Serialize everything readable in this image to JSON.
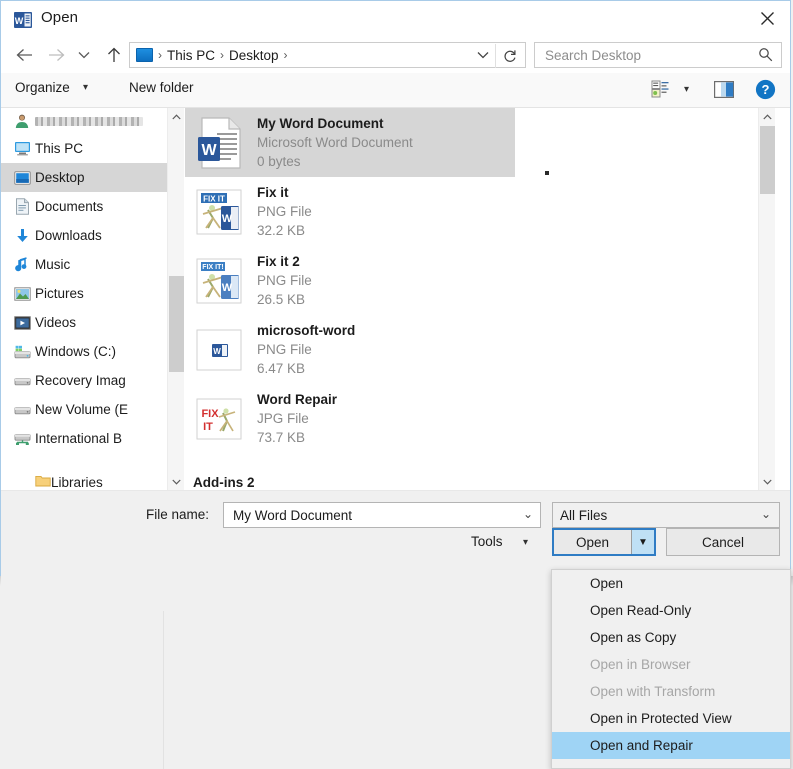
{
  "window": {
    "title": "Open",
    "title_icon": "word-document-icon",
    "close_icon": "close-icon"
  },
  "nav": {
    "back_icon": "arrow-left-icon",
    "forward_icon": "arrow-right-icon",
    "recent_icon": "chevron-down-icon",
    "up_icon": "arrow-up-icon",
    "breadcrumb_icon": "desktop-monitor-icon",
    "breadcrumbs": [
      "This PC",
      "Desktop"
    ],
    "separator": "›",
    "dropdown_icon": "chevron-down-icon",
    "refresh_icon": "refresh-icon"
  },
  "search": {
    "placeholder": "Search Desktop",
    "value": "",
    "icon": "search-icon"
  },
  "commandbar": {
    "organize_label": "Organize",
    "organize_chevron": "▾",
    "new_folder_label": "New folder",
    "view_icon": "view-layout-icon",
    "view_chevron": "▾",
    "preview_pane_icon": "preview-pane-icon",
    "help_icon": "help-circle-icon"
  },
  "sidebar": {
    "user": {
      "label": "",
      "icon": "user-account-icon",
      "redacted": true
    },
    "items": [
      {
        "label": "This PC",
        "icon": "computer-icon",
        "selected": false
      },
      {
        "label": "Desktop",
        "icon": "desktop-icon",
        "selected": true
      },
      {
        "label": "Documents",
        "icon": "documents-icon",
        "selected": false
      },
      {
        "label": "Downloads",
        "icon": "downloads-icon",
        "selected": false
      },
      {
        "label": "Music",
        "icon": "music-icon",
        "selected": false
      },
      {
        "label": "Pictures",
        "icon": "pictures-icon",
        "selected": false
      },
      {
        "label": "Videos",
        "icon": "videos-icon",
        "selected": false
      },
      {
        "label": "Windows (C:)",
        "icon": "windows-drive-icon",
        "selected": false
      },
      {
        "label": "Recovery Imag",
        "icon": "drive-icon",
        "selected": false
      },
      {
        "label": "New Volume (E",
        "icon": "drive-icon",
        "selected": false
      },
      {
        "label": "International B",
        "icon": "network-drive-icon",
        "selected": false
      }
    ],
    "partial_item": {
      "label": "Libraries",
      "icon": "libraries-icon"
    },
    "scroll_up_icon": "chevron-up-icon",
    "scroll_down_icon": "chevron-down-icon"
  },
  "filelist": {
    "files": [
      {
        "name": "My Word Document",
        "type": "Microsoft Word Document",
        "size": "0 bytes",
        "icon": "word-doc-icon",
        "selected": true
      },
      {
        "name": "Fix it",
        "type": "PNG File",
        "size": "32.2 KB",
        "icon": "fixit-word-icon",
        "selected": false
      },
      {
        "name": "Fix it 2",
        "type": "PNG File",
        "size": "26.5 KB",
        "icon": "fixit2-word-icon",
        "selected": false
      },
      {
        "name": "microsoft-word",
        "type": "PNG File",
        "size": "6.47 KB",
        "icon": "word-small-icon",
        "selected": false
      },
      {
        "name": "Word Repair",
        "type": "JPG File",
        "size": "73.7 KB",
        "icon": "fixit-red-icon",
        "selected": false
      }
    ],
    "partial_file": {
      "name": "Add-ins 2"
    },
    "scroll_up_icon": "chevron-up-icon",
    "scroll_down_icon": "chevron-down-icon"
  },
  "footer": {
    "filename_label": "File name:",
    "filename_value": "My Word Document",
    "filename_chevron": "⌄",
    "filter_value": "All Files",
    "filter_chevron": "⌄",
    "tools_label": "Tools",
    "tools_chevron": "▾",
    "open_label": "Open",
    "open_arrow": "▼",
    "cancel_label": "Cancel"
  },
  "dropdown_menu": {
    "items": [
      {
        "label": "Open",
        "disabled": false,
        "highlighted": false
      },
      {
        "label": "Open Read-Only",
        "disabled": false,
        "highlighted": false
      },
      {
        "label": "Open as Copy",
        "disabled": false,
        "highlighted": false
      },
      {
        "label": "Open in Browser",
        "disabled": true,
        "highlighted": false
      },
      {
        "label": "Open with Transform",
        "disabled": true,
        "highlighted": false
      },
      {
        "label": "Open in Protected View",
        "disabled": false,
        "highlighted": false
      },
      {
        "label": "Open and Repair",
        "disabled": false,
        "highlighted": true
      }
    ]
  },
  "colors": {
    "highlight_blue": "#9fd4f5",
    "selection_gray": "#d6d6d6",
    "focus_border": "#2f7cc4",
    "word_blue": "#2b579a",
    "help_blue": "#1275c4"
  }
}
